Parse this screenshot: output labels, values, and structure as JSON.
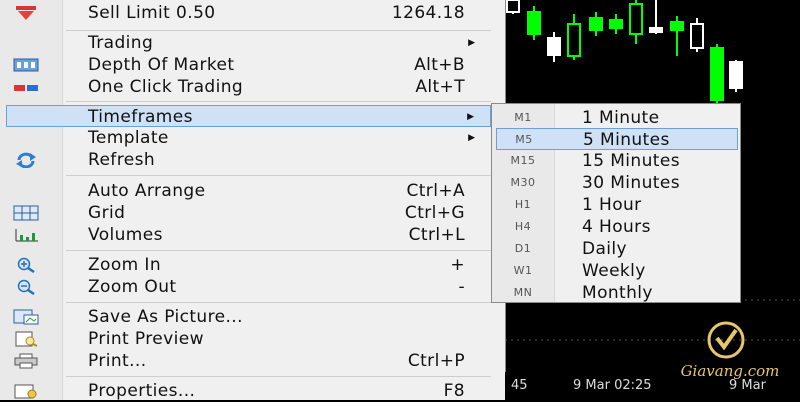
{
  "menu": {
    "items": [
      {
        "id": "sell-limit",
        "label": "Sell Limit 0.50",
        "shortcut": "1264.18",
        "icon": "sell-arrow-icon"
      },
      {
        "id": "trading",
        "label": "Trading",
        "submenu": true
      },
      {
        "id": "depth-of-market",
        "label": "Depth Of Market",
        "shortcut": "Alt+B",
        "icon": "depth-of-market-icon"
      },
      {
        "id": "one-click-trading",
        "label": "One Click Trading",
        "shortcut": "Alt+T",
        "icon": "one-click-trading-icon"
      },
      {
        "id": "timeframes",
        "label": "Timeframes",
        "submenu": true,
        "highlighted": true
      },
      {
        "id": "template",
        "label": "Template",
        "submenu": true
      },
      {
        "id": "refresh",
        "label": "Refresh",
        "icon": "refresh-icon"
      },
      {
        "id": "auto-arrange",
        "label": "Auto Arrange",
        "shortcut": "Ctrl+A"
      },
      {
        "id": "grid",
        "label": "Grid",
        "shortcut": "Ctrl+G",
        "icon": "grid-icon"
      },
      {
        "id": "volumes",
        "label": "Volumes",
        "shortcut": "Ctrl+L",
        "icon": "volumes-icon"
      },
      {
        "id": "zoom-in",
        "label": "Zoom In",
        "shortcut": "+",
        "icon": "zoom-in-icon"
      },
      {
        "id": "zoom-out",
        "label": "Zoom Out",
        "shortcut": "-",
        "icon": "zoom-out-icon"
      },
      {
        "id": "save-as-picture",
        "label": "Save As Picture...",
        "icon": "save-picture-icon"
      },
      {
        "id": "print-preview",
        "label": "Print Preview",
        "icon": "print-preview-icon"
      },
      {
        "id": "print",
        "label": "Print...",
        "shortcut": "Ctrl+P",
        "icon": "printer-icon"
      },
      {
        "id": "properties",
        "label": "Properties...",
        "shortcut": "F8",
        "icon": "properties-icon"
      }
    ],
    "submenu_arrow": "▶"
  },
  "timeframes": {
    "items": [
      {
        "code": "M1",
        "label": "1 Minute"
      },
      {
        "code": "M5",
        "label": "5 Minutes",
        "highlighted": true
      },
      {
        "code": "M15",
        "label": "15 Minutes"
      },
      {
        "code": "M30",
        "label": "30 Minutes"
      },
      {
        "code": "H1",
        "label": "1 Hour"
      },
      {
        "code": "H4",
        "label": "4 Hours"
      },
      {
        "code": "D1",
        "label": "Daily"
      },
      {
        "code": "W1",
        "label": "Weekly"
      },
      {
        "code": "MN",
        "label": "Monthly"
      }
    ]
  },
  "axis": {
    "labels": [
      "45",
      "9 Mar 02:25",
      "9 Mar"
    ]
  },
  "watermark": {
    "brand": "Giavang.com"
  },
  "colors": {
    "bull": "#00ff00",
    "bear": "#ffffff",
    "highlight": "#cfe1f6",
    "brand": "#e8c66a"
  }
}
